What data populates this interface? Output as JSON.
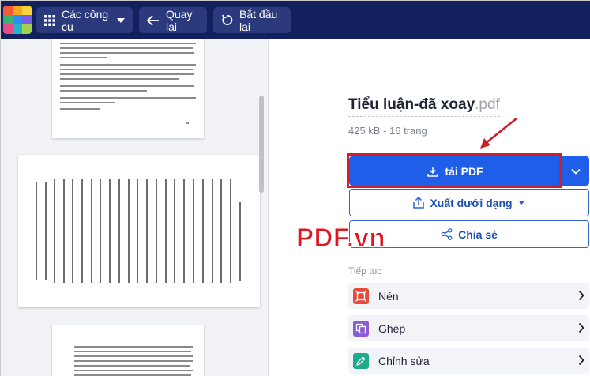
{
  "topbar": {
    "tools_label": "Các công cụ",
    "back_label": "Quay lại",
    "restart_label": "Bắt đầu lại",
    "background": "#13205e",
    "button_bg": "#2a3a7c"
  },
  "file": {
    "name": "Tiểu luận-đã xoay",
    "extension": ".pdf",
    "meta": "425 kB - 16 trang"
  },
  "actions": {
    "download_label": "tải PDF",
    "export_label": "Xuất dưới dạng",
    "share_label": "Chia sẻ",
    "accent": "#1f5ee8"
  },
  "annotation": {
    "highlight_color": "#cc1f2b"
  },
  "watermark": "PDF.vn",
  "next_steps": {
    "label": "Tiếp tục",
    "items": [
      {
        "label": "Nén",
        "icon": "compress-icon",
        "color": "#e84a3c"
      },
      {
        "label": "Ghép",
        "icon": "merge-icon",
        "color": "#8a5bd6"
      },
      {
        "label": "Chỉnh sửa",
        "icon": "edit-icon",
        "color": "#1faa8e"
      }
    ]
  }
}
